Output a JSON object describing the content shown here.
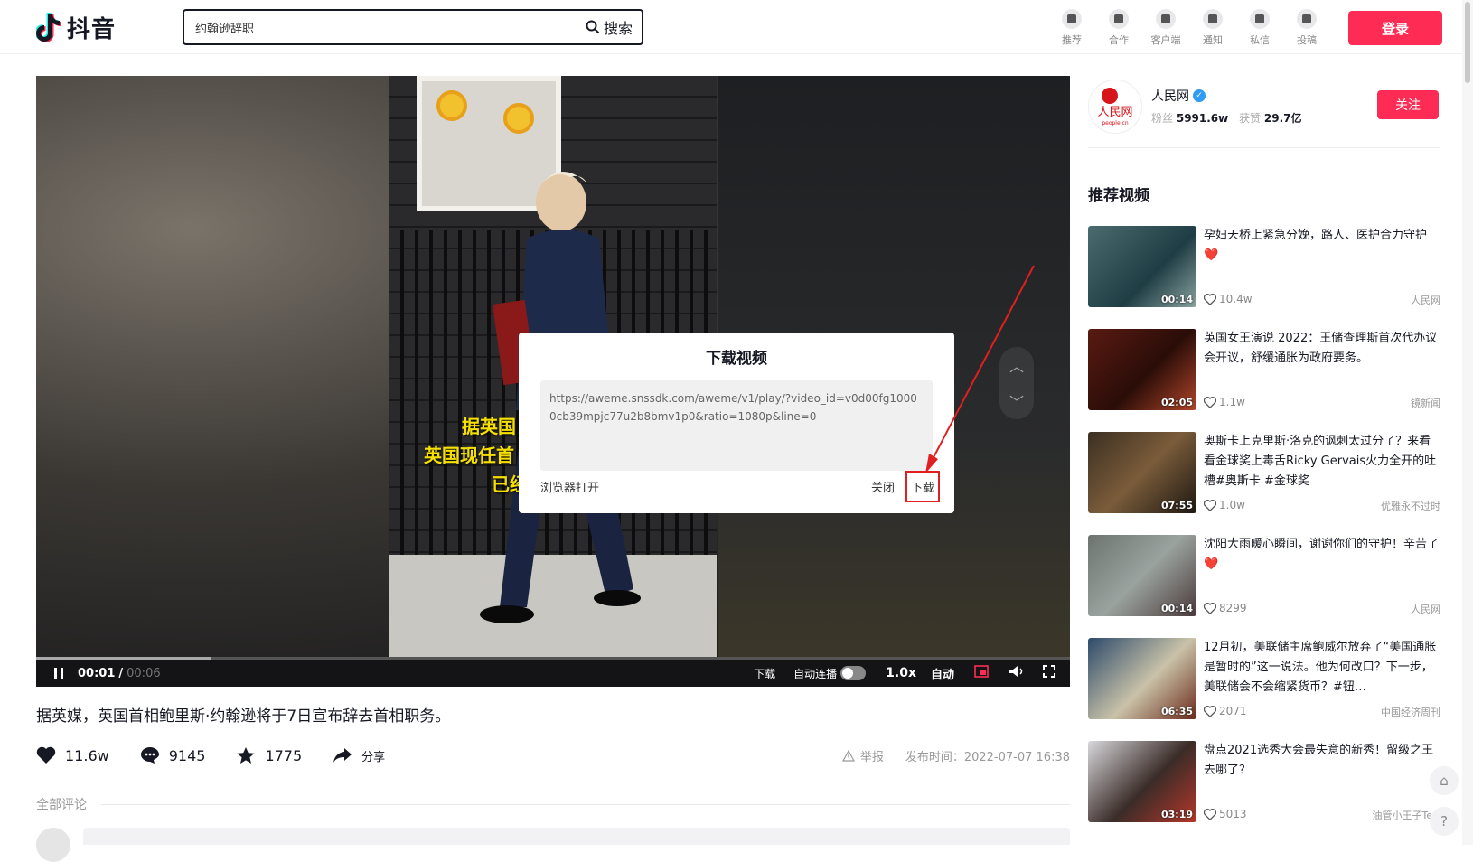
{
  "header": {
    "logo_text": "抖音",
    "search_value": "约翰逊辞职",
    "search_button": "搜索",
    "nav": [
      {
        "label": "推荐",
        "icon": "home-icon"
      },
      {
        "label": "合作",
        "icon": "handshake-icon"
      },
      {
        "label": "客户端",
        "icon": "download-client-icon"
      },
      {
        "label": "通知",
        "icon": "bell-icon"
      },
      {
        "label": "私信",
        "icon": "message-icon"
      },
      {
        "label": "投稿",
        "icon": "upload-icon"
      }
    ],
    "login_button": "登录"
  },
  "player": {
    "subtitle_lines": [
      "据英国",
      "英国现任首",
      "已经"
    ],
    "current_time": "00:01",
    "time_separator": "/",
    "duration": "00:06",
    "progress": 0.17,
    "download_label": "下载",
    "autoplay_label": "自动连播",
    "speed": "1.0x",
    "quality": "自动"
  },
  "modal": {
    "title": "下载视频",
    "url": "https://aweme.snssdk.com/aweme/v1/play/?video_id=v0d00fg10000cb39mpjc77u2b8bmv1p0&ratio=1080p&line=0",
    "open_in_browser": "浏览器打开",
    "close": "关闭",
    "download": "下载",
    "highlight_color": "#e02020"
  },
  "video_info": {
    "description": "据英媒，英国首相鲍里斯·约翰逊将于7日宣布辞去首相职务。",
    "likes": "11.6w",
    "comments": "9145",
    "favorites": "1775",
    "share": "分享",
    "report": "举报",
    "publish_time": "发布时间：2022-07-07 16:38",
    "comments_title": "全部评论"
  },
  "author": {
    "name": "人民网",
    "fans_label": "粉丝",
    "fans": "5991.6w",
    "likes_label": "获赞",
    "likes": "29.7亿",
    "follow_button": "关注",
    "avatar_text": "人民网",
    "avatar_sub": "people.cn"
  },
  "recommend": {
    "title": "推荐视频",
    "items": [
      {
        "title": "孕妇天桥上紧急分娩，路人、医护合力守护❤️",
        "duration": "00:14",
        "likes": "10.4w",
        "author": "人民网"
      },
      {
        "title": "英国女王演说 2022：王储查理斯首次代办议会开议，舒缓通胀为政府要务。",
        "duration": "02:05",
        "likes": "1.1w",
        "author": "镜新闻"
      },
      {
        "title": "奥斯卡上克里斯·洛克的讽刺太过分了？来看看金球奖上毒舌Ricky Gervais火力全开的吐槽#奥斯卡 #金球奖",
        "duration": "07:55",
        "likes": "1.0w",
        "author": "优雅永不过时"
      },
      {
        "title": "沈阳大雨暖心瞬间，谢谢你们的守护！辛苦了❤️",
        "duration": "00:14",
        "likes": "8299",
        "author": "人民网"
      },
      {
        "title": "12月初，美联储主席鲍威尔放弃了“美国通胀是暂时的”这一说法。他为何改口？下一步，美联储会不会缩紧货币？#钮…",
        "duration": "06:35",
        "likes": "2071",
        "author": "中国经济周刊"
      },
      {
        "title": "盘点2021选秀大会最失意的新秀！留级之王去哪了？",
        "duration": "03:19",
        "likes": "5013",
        "author": "油管小王子Terr"
      }
    ]
  },
  "colors": {
    "brand": "#fe2c55",
    "verified": "#2f9cf4",
    "subtitle": "#f5e000"
  }
}
